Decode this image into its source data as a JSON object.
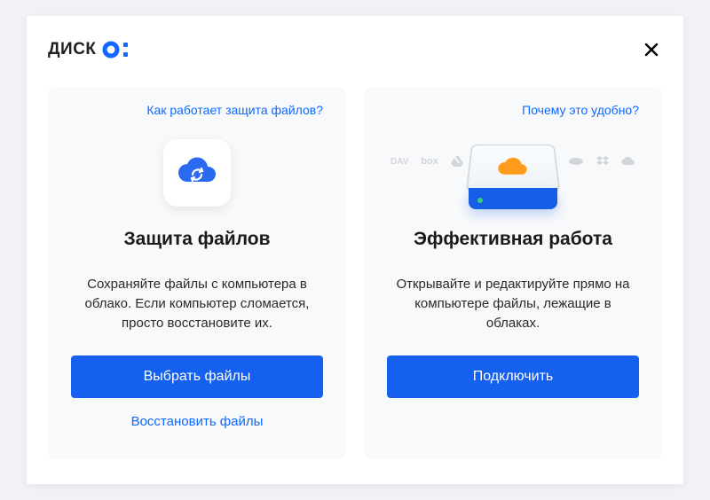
{
  "brand": {
    "name": "ДИСК"
  },
  "cards": {
    "protect": {
      "help_link": "Как работает защита файлов?",
      "title": "Защита файлов",
      "description": "Сохраняйте файлы с компьютера в облако. Если компьютер сломается, просто восстановите их.",
      "primary_button": "Выбрать файлы",
      "secondary_link": "Восстановить файлы"
    },
    "work": {
      "help_link": "Почему это удобно?",
      "title": "Эффективная работа",
      "description": "Открывайте и редактируйте прямо на компьютере файлы, лежащие в облаках.",
      "primary_button": "Подключить",
      "providers": {
        "dav": "DAV",
        "box": "box"
      }
    }
  }
}
